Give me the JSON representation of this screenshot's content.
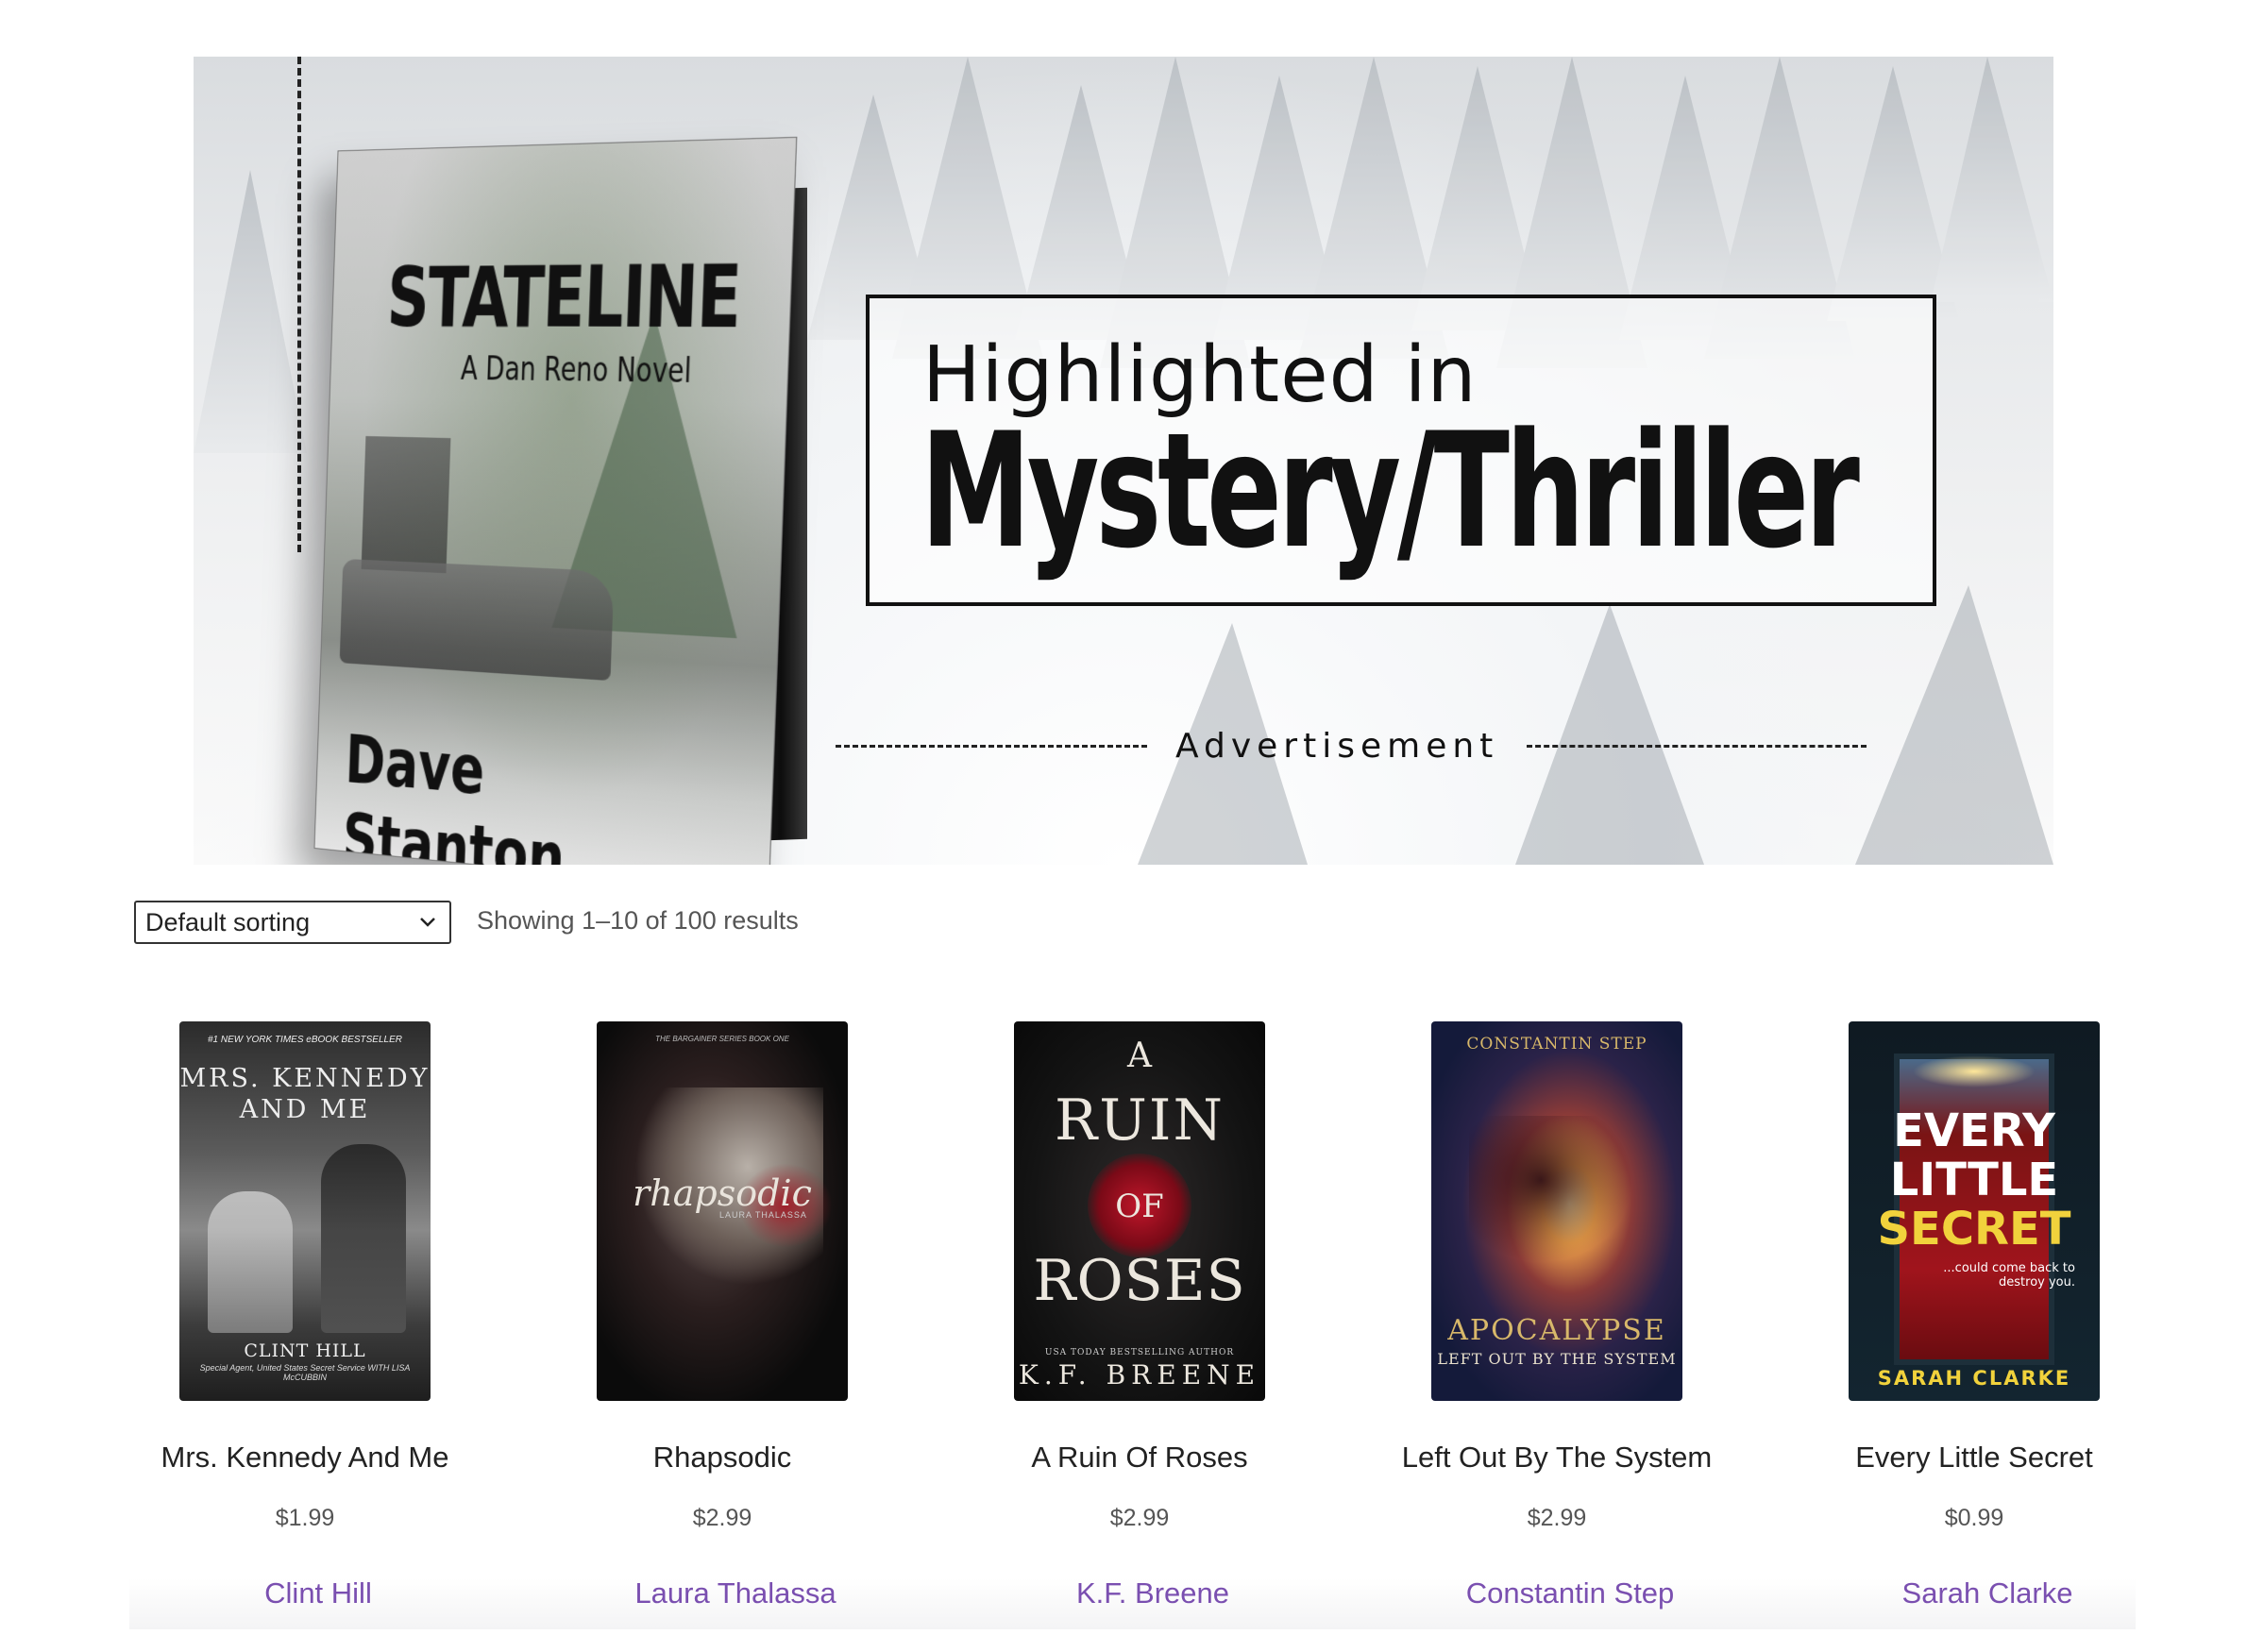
{
  "banner": {
    "book": {
      "title": "STATELINE",
      "subtitle": "A Dan Reno Novel",
      "author": "Dave Stanton"
    },
    "highlight_line1": "Highlighted in",
    "highlight_line2": "Mystery/Thriller",
    "ad_label": "Advertisement"
  },
  "toolbar": {
    "sort_selected": "Default sorting",
    "result_count": "Showing 1–10 of 100 results"
  },
  "products": [
    {
      "title": "Mrs. Kennedy And Me",
      "price": "$1.99",
      "author": "Clint Hill",
      "cover": {
        "top": "#1 NEW YORK TIMES eBOOK BESTSELLER",
        "title": "MRS. KENNEDY AND ME",
        "author": "CLINT HILL",
        "sub": "Special Agent, United States Secret Service WITH LISA McCUBBIN"
      }
    },
    {
      "title": "Rhapsodic",
      "price": "$2.99",
      "author": "Laura Thalassa",
      "cover": {
        "top": "THE BARGAINER SERIES BOOK ONE",
        "title": "rhapsodic",
        "author": "LAURA THALASSA"
      }
    },
    {
      "title": "A Ruin Of Roses",
      "price": "$2.99",
      "author": "K.F. Breene",
      "cover": {
        "a": "A",
        "ruin": "RUIN",
        "of": "OF",
        "roses": "ROSES",
        "sub": "USA TODAY BESTSELLING AUTHOR",
        "author": "K.F. BREENE"
      }
    },
    {
      "title": "Left Out By The System",
      "price": "$2.99",
      "author": "Constantin Step",
      "cover": {
        "author": "CONSTANTIN STEP",
        "title": "APOCALYPSE",
        "sub": "LEFT OUT BY THE SYSTEM"
      }
    },
    {
      "title": "Every Little Secret",
      "price": "$0.99",
      "author": "Sarah Clarke",
      "cover": {
        "every": "EVERY",
        "little": "LITTLE",
        "secret": "SECRET",
        "tag": "...could come back to destroy you.",
        "author": "SARAH CLARKE"
      }
    }
  ],
  "colors": {
    "author_link": "#7a4fb0",
    "price": "#555555"
  },
  "icons": {
    "sort_dropdown": "chevron-down-icon"
  }
}
